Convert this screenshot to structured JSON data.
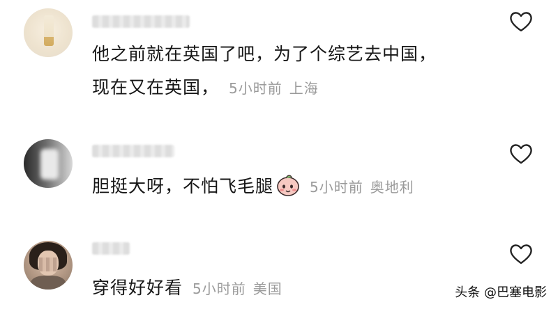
{
  "comments": [
    {
      "lines": [
        "他之前就在英国了吧，为了个综艺去中国，",
        "现在又在英国，"
      ],
      "time": "5小时前",
      "location": "上海"
    },
    {
      "lines": [
        "胆挺大呀，不怕飞毛腿"
      ],
      "time": "5小时前",
      "location": "奥地利"
    },
    {
      "lines": [
        "穿得好好看"
      ],
      "time": "5小时前",
      "location": "美国"
    }
  ],
  "watermark": "头条 @巴塞电影",
  "colors": {
    "text": "#161616",
    "meta": "#9a9a9a",
    "heart": "#222222"
  },
  "icons": {
    "like": "heart-outline-icon",
    "emoji": "peach-face-emoji"
  }
}
